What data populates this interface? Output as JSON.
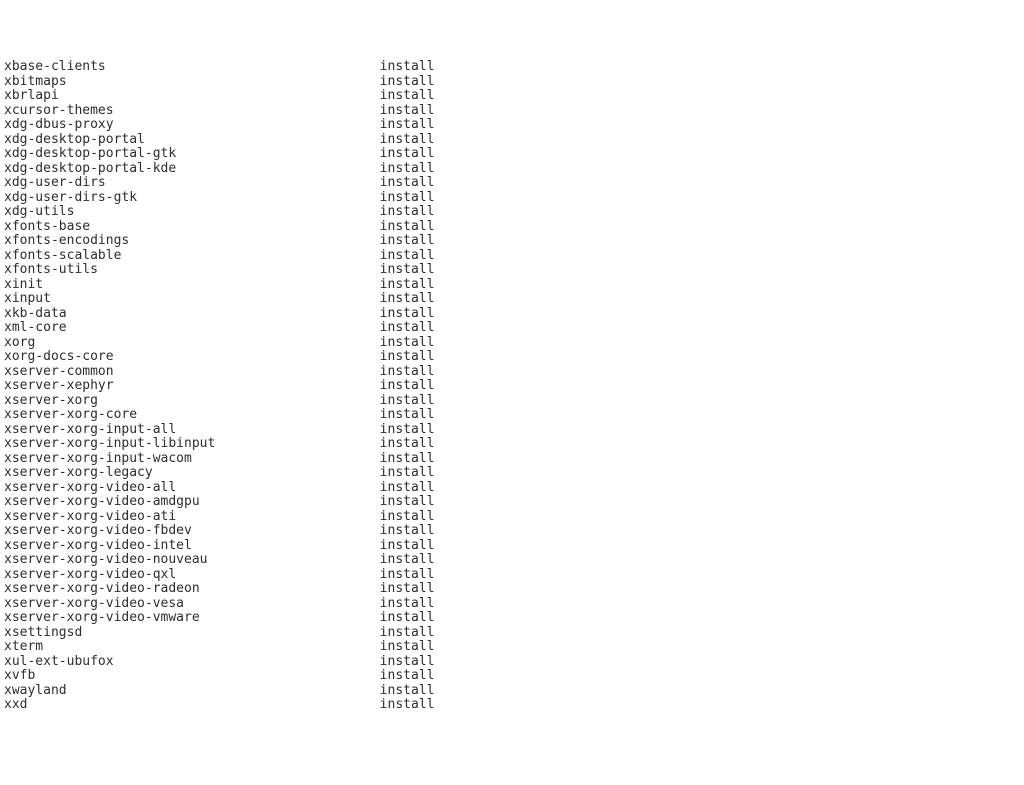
{
  "packages": [
    {
      "name": "xbase-clients",
      "status": "install"
    },
    {
      "name": "xbitmaps",
      "status": "install"
    },
    {
      "name": "xbrlapi",
      "status": "install"
    },
    {
      "name": "xcursor-themes",
      "status": "install"
    },
    {
      "name": "xdg-dbus-proxy",
      "status": "install"
    },
    {
      "name": "xdg-desktop-portal",
      "status": "install"
    },
    {
      "name": "xdg-desktop-portal-gtk",
      "status": "install"
    },
    {
      "name": "xdg-desktop-portal-kde",
      "status": "install"
    },
    {
      "name": "xdg-user-dirs",
      "status": "install"
    },
    {
      "name": "xdg-user-dirs-gtk",
      "status": "install"
    },
    {
      "name": "xdg-utils",
      "status": "install"
    },
    {
      "name": "xfonts-base",
      "status": "install"
    },
    {
      "name": "xfonts-encodings",
      "status": "install"
    },
    {
      "name": "xfonts-scalable",
      "status": "install"
    },
    {
      "name": "xfonts-utils",
      "status": "install"
    },
    {
      "name": "xinit",
      "status": "install"
    },
    {
      "name": "xinput",
      "status": "install"
    },
    {
      "name": "xkb-data",
      "status": "install"
    },
    {
      "name": "xml-core",
      "status": "install"
    },
    {
      "name": "xorg",
      "status": "install"
    },
    {
      "name": "xorg-docs-core",
      "status": "install"
    },
    {
      "name": "xserver-common",
      "status": "install"
    },
    {
      "name": "xserver-xephyr",
      "status": "install"
    },
    {
      "name": "xserver-xorg",
      "status": "install"
    },
    {
      "name": "xserver-xorg-core",
      "status": "install"
    },
    {
      "name": "xserver-xorg-input-all",
      "status": "install"
    },
    {
      "name": "xserver-xorg-input-libinput",
      "status": "install"
    },
    {
      "name": "xserver-xorg-input-wacom",
      "status": "install"
    },
    {
      "name": "xserver-xorg-legacy",
      "status": "install"
    },
    {
      "name": "xserver-xorg-video-all",
      "status": "install"
    },
    {
      "name": "xserver-xorg-video-amdgpu",
      "status": "install"
    },
    {
      "name": "xserver-xorg-video-ati",
      "status": "install"
    },
    {
      "name": "xserver-xorg-video-fbdev",
      "status": "install"
    },
    {
      "name": "xserver-xorg-video-intel",
      "status": "install"
    },
    {
      "name": "xserver-xorg-video-nouveau",
      "status": "install"
    },
    {
      "name": "xserver-xorg-video-qxl",
      "status": "install"
    },
    {
      "name": "xserver-xorg-video-radeon",
      "status": "install"
    },
    {
      "name": "xserver-xorg-video-vesa",
      "status": "install"
    },
    {
      "name": "xserver-xorg-video-vmware",
      "status": "install"
    },
    {
      "name": "xsettingsd",
      "status": "install"
    },
    {
      "name": "xterm",
      "status": "install"
    },
    {
      "name": "xul-ext-ubufox",
      "status": "install"
    },
    {
      "name": "xvfb",
      "status": "install"
    },
    {
      "name": "xwayland",
      "status": "install"
    },
    {
      "name": "xxd",
      "status": "install"
    }
  ],
  "nameColWidth": 48
}
